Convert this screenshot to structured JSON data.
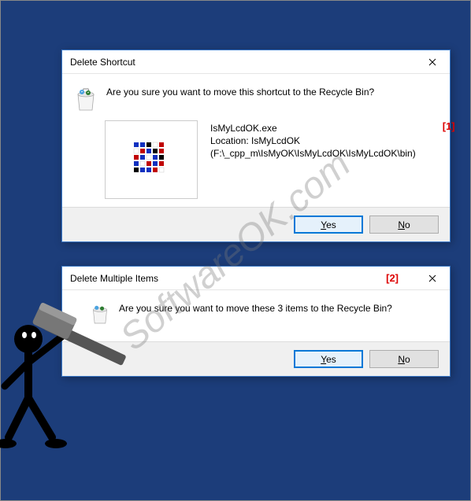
{
  "dialog1": {
    "title": "Delete Shortcut",
    "prompt": "Are you sure you want to move this shortcut to the Recycle Bin?",
    "item_name": "IsMyLcdOK.exe",
    "item_location_label": "Location: IsMyLcdOK",
    "item_path": "(F:\\_cpp_m\\IsMyOK\\IsMyLcdOK\\IsMyLcdOK\\bin)",
    "annotation": "[1]",
    "yes": "Yes",
    "no": "No"
  },
  "dialog2": {
    "title": "Delete Multiple Items",
    "prompt": "Are you sure you want to move these 3 items to the Recycle Bin?",
    "annotation": "[2]",
    "yes": "Yes",
    "no": "No"
  },
  "watermark": "SoftwareOK.com"
}
